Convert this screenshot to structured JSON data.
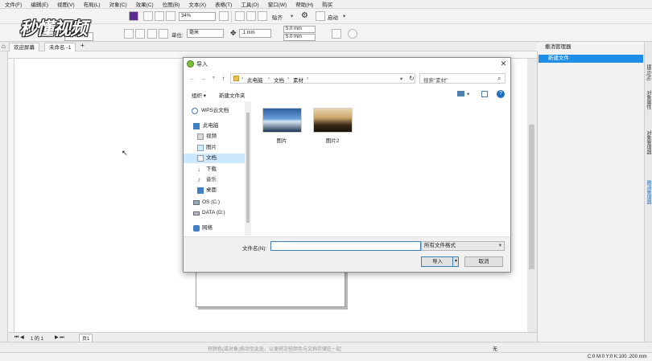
{
  "menu": [
    "文件(F)",
    "编辑(E)",
    "视图(V)",
    "布局(L)",
    "对象(C)",
    "效果(C)",
    "位图(B)",
    "文本(X)",
    "表格(T)",
    "工具(O)",
    "窗口(W)",
    "帮助(H)",
    "购买"
  ],
  "watermark": "秒懂视频",
  "toolbar": {
    "zoom": "34%",
    "snap_label": "贴齐",
    "launch_label": "启动",
    "size_value": "2.0 mm",
    "unit_label": "单位:",
    "unit_value": "毫米",
    "nudge_value": ".1 mm",
    "dup_x": "5.0 mm",
    "dup_y": "5.0 mm"
  },
  "tabs": {
    "welcome": "欢迎屏幕",
    "untitled": "未命名 -1"
  },
  "docker": {
    "title": "撤消管理器",
    "item": "新建文件",
    "side_tabs": [
      "提示(N)",
      "对象属性",
      "对象管理器",
      "撤消管理器"
    ]
  },
  "pagebar": {
    "page_of": "1 的 1",
    "page_tab": "页1"
  },
  "status": {
    "hint": "将颜色(或对象)拖动至此处，以便将这些颜色与文档存储在一起",
    "color_info": "C:0 M:0 Y:0 K:100 .200 mm",
    "no_fill": "无"
  },
  "dialog": {
    "title": "导入",
    "breadcrumb": [
      "此电脑",
      "文档",
      "素材"
    ],
    "search_placeholder": "搜索\"素材\"",
    "organize": "组织 ▾",
    "new_folder": "新建文件夹",
    "nav": [
      {
        "label": "WPS云文档",
        "icon": "cloud-icon"
      },
      {
        "label": "此电脑",
        "icon": "computer-icon"
      },
      {
        "label": "视频",
        "icon": "video-folder-icon"
      },
      {
        "label": "图片",
        "icon": "pictures-folder-icon"
      },
      {
        "label": "文档",
        "icon": "documents-folder-icon",
        "selected": true
      },
      {
        "label": "下载",
        "icon": "download-folder-icon"
      },
      {
        "label": "音乐",
        "icon": "music-folder-icon"
      },
      {
        "label": "桌面",
        "icon": "desktop-folder-icon"
      },
      {
        "label": "OS (C:)",
        "icon": "drive-icon"
      },
      {
        "label": "DATA (D:)",
        "icon": "drive-icon"
      },
      {
        "label": "网络",
        "icon": "network-icon"
      }
    ],
    "files": [
      {
        "name": "图片"
      },
      {
        "name": "图片2"
      }
    ],
    "filename_label": "文件名(N):",
    "filename_value": "",
    "filetype": "所有文件格式",
    "import_button": "导入",
    "cancel_button": "取消"
  }
}
